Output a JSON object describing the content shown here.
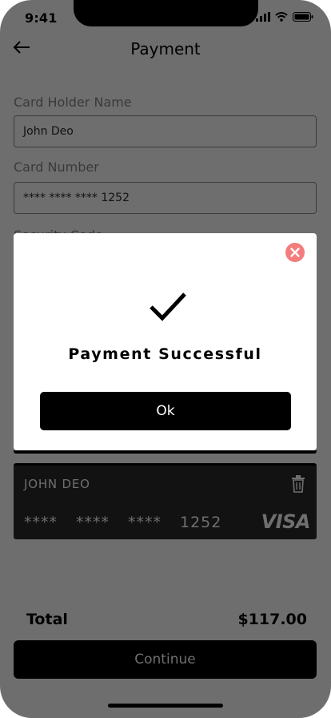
{
  "status_bar": {
    "time": "9:41"
  },
  "header": {
    "title": "Payment"
  },
  "form": {
    "card_holder_label": "Card Holder Name",
    "card_holder_value": "John Deo",
    "card_number_label": "Card Number",
    "card_number_value": "**** **** **** 1252",
    "security_code_label": "Security Code"
  },
  "card": {
    "holder": "JOHN DEO",
    "groups": [
      "****",
      "****",
      "****",
      "1252"
    ],
    "brand": "VISA"
  },
  "summary": {
    "total_label": "Total",
    "total_value": "$117.00"
  },
  "buttons": {
    "continue_label": "Continue"
  },
  "modal": {
    "title": "Payment Successful",
    "ok_label": "Ok",
    "close_color": "#f47c7c"
  }
}
